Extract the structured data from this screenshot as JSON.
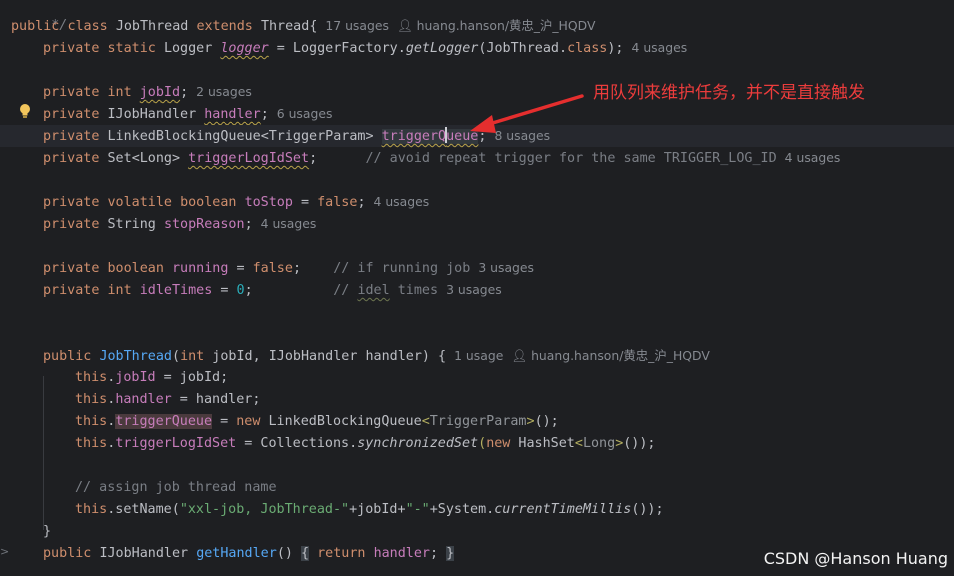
{
  "editor": {
    "top_comment": "*/",
    "hint_author": "huang.hanson/黄忠_沪_HQDV",
    "class_decl": {
      "kw_public": "public",
      "kw_class": "class",
      "name": "JobThread",
      "kw_extends": "extends",
      "super": "Thread",
      "brace": "{",
      "usages": "17 usages"
    },
    "logger_line": {
      "kw_private": "private",
      "kw_static": "static",
      "type": "Logger",
      "name": "logger",
      "eq": " = LoggerFactory.",
      "method": "getLogger",
      "args": "(JobThread.",
      "kw_cls": "class",
      "end": ");",
      "usages": "4 usages"
    },
    "jobid_line": {
      "kw_private": "private",
      "kw_int": "int",
      "name": "jobId",
      "end": ";",
      "usages": "2 usages"
    },
    "handler_line": {
      "kw_private": "private",
      "type": "IJobHandler",
      "name": "handler",
      "end": ";",
      "usages": "6 usages"
    },
    "queue_line": {
      "kw_private": "private",
      "type_a": "LinkedBlockingQueue",
      "lt": "<",
      "type_param": "TriggerParam",
      "gt": ">",
      "name_a": "triggerQ",
      "name_b": "ueue",
      "end": ";",
      "usages": "8 usages"
    },
    "logidset_line": {
      "kw_private": "private",
      "type": "Set",
      "lt": "<",
      "type_param": "Long",
      "gt": ">",
      "name": "triggerLogIdSet",
      "end": ";",
      "comment": "// avoid repeat trigger for the same TRIGGER_LOG_ID",
      "usages": "4 usages"
    },
    "tostop_line": {
      "kw_private": "private",
      "kw_volatile": "volatile",
      "kw_boolean": "boolean",
      "name": "toStop",
      "eq": " = ",
      "val": "false",
      "end": ";",
      "usages": "4 usages"
    },
    "stopreason_line": {
      "kw_private": "private",
      "type": "String",
      "name": "stopReason",
      "end": ";",
      "usages": "4 usages"
    },
    "running_line": {
      "kw_private": "private",
      "kw_boolean": "boolean",
      "name": "running",
      "eq": " = ",
      "val": "false",
      "end": ";",
      "comment": "// if running job",
      "usages": "3 usages"
    },
    "idle_line": {
      "kw_private": "private",
      "kw_int": "int",
      "name": "idleTimes",
      "eq": " = ",
      "val": "0",
      "end": ";",
      "comment_a": "// ",
      "comment_b": "idel",
      "comment_c": " times",
      "usages": "3 usages"
    },
    "ctor_line": {
      "kw_public": "public",
      "name": "JobThread",
      "open": "(",
      "kw_int": "int",
      "params": " jobId, IJobHandler handler) ",
      "brace": "{",
      "usages": "1 usage"
    },
    "assign_jobid": {
      "kw_this": "this",
      "dot": ".",
      "field": "jobId",
      "rest": " = jobId;"
    },
    "assign_handler": {
      "kw_this": "this",
      "dot": ".",
      "field": "handler",
      "rest": " = handler;"
    },
    "assign_queue": {
      "kw_this": "this",
      "dot": ".",
      "field": "triggerQueue",
      "eq": " = ",
      "kw_new": "new",
      "type": " LinkedBlockingQueue",
      "lt": "<",
      "type_param": "TriggerParam",
      "gt": ">",
      "end": "();"
    },
    "assign_logidset": {
      "kw_this": "this",
      "dot": ".",
      "field": "triggerLogIdSet",
      "eq": " = Collections.",
      "method": "synchronizedSet",
      "open": "(",
      "kw_new": "new",
      "type": " HashSet",
      "lt": "<",
      "type_param": "Long",
      "gt": ">",
      "end": "());"
    },
    "comment_assign": "// assign job thread name",
    "setname_line": {
      "kw_this": "this",
      "call": ".setName(",
      "str_a": "\"xxl-job, JobThread-\"",
      "plus_a": "+jobId+",
      "str_b": "\"-\"",
      "plus_b": "+System.",
      "method": "currentTimeMillis",
      "end": "());"
    },
    "close_brace": "}",
    "gethandler_line": {
      "kw_public": "public",
      "type": "IJobHandler",
      "name": "getHandler",
      "parens": "()",
      "open": "{",
      "kw_return": "return",
      "field": "handler",
      "semi": ";",
      "close": "}"
    }
  },
  "annotation_text": "用队列来维护任务，并不是直接触发",
  "watermark": "CSDN @Hanson Huang",
  "colors": {
    "background": "#1e1f22",
    "keyword": "#cf8e6d",
    "field": "#c77dbb",
    "method": "#56a8f5",
    "number": "#2aacb8",
    "string": "#6aab73",
    "annotation_red": "#ec3c3c"
  },
  "icons": [
    "lightbulb-icon",
    "person-icon",
    "arrow-annotation"
  ]
}
